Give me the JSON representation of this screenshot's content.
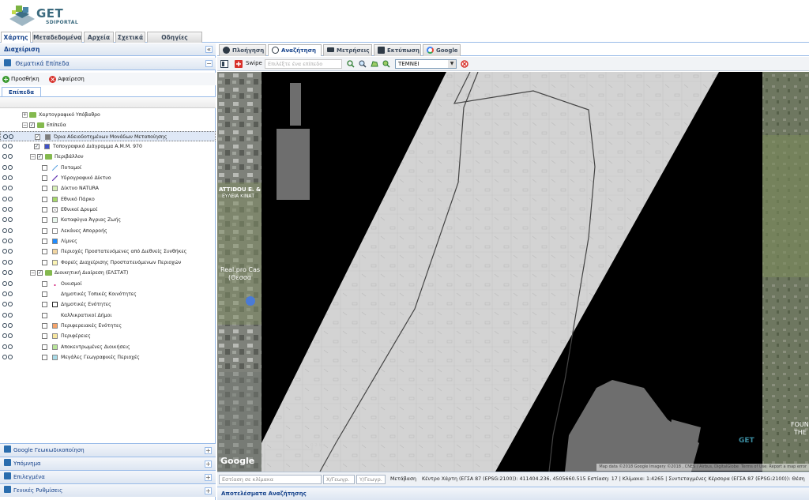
{
  "header": {
    "logo_title": "GET",
    "logo_subtitle": "SDIPORTAL"
  },
  "main_tabs": [
    {
      "label": "Χάρτης",
      "active": true
    },
    {
      "label": "Μεταδεδομένα",
      "active": false
    },
    {
      "label": "Αρχεία",
      "active": false
    },
    {
      "label": "Σχετικά",
      "active": false
    },
    {
      "label": "Οδηγίες Χρήσης",
      "active": false
    }
  ],
  "left_panel": {
    "title": "Διαχείριση",
    "thematic_title": "Θεματικά Επίπεδα",
    "add_label": "Προσθήκη",
    "remove_label": "Αφαίρεση",
    "layers_tab": "Επίπεδα",
    "tree": [
      {
        "label": "Χαρτογραφικό Υπόβαθρο",
        "indent": 0,
        "type": "folder",
        "expander": "+",
        "checked": false,
        "actions": false
      },
      {
        "label": "Επίπεδα",
        "indent": 0,
        "type": "folder",
        "expander": "-",
        "checked": true,
        "actions": false
      },
      {
        "label": "Όρια Αδειοδοτημένων Μονάδων Μεταποίησης",
        "indent": 1,
        "type": "layer",
        "checked": true,
        "actions": true,
        "selected": true,
        "symbol": "#7d7d7d"
      },
      {
        "label": "Τοπογραφικό Διάγραμμα Α.Μ.Μ. 970",
        "indent": 1,
        "type": "layer",
        "checked": true,
        "actions": true,
        "symbol": "#3f51c9"
      },
      {
        "label": "Περιβάλλον",
        "indent": 1,
        "type": "folder",
        "expander": "-",
        "checked": true,
        "actions": true
      },
      {
        "label": "Ποταμοί",
        "indent": 2,
        "type": "layer",
        "checked": false,
        "actions": true,
        "symbol": "line-blue"
      },
      {
        "label": "Υδρογραφικό Δίκτυο",
        "indent": 2,
        "type": "layer",
        "checked": false,
        "actions": true,
        "symbol": "line-purple"
      },
      {
        "label": "Δίκτυο NATURA",
        "indent": 2,
        "type": "layer",
        "checked": false,
        "actions": true,
        "symbol": "#d8f0b8"
      },
      {
        "label": "Εθνικό Πάρκο",
        "indent": 2,
        "type": "layer",
        "checked": false,
        "actions": true,
        "symbol": "#a6d96a"
      },
      {
        "label": "Εθνικοί Δρυμοί",
        "indent": 2,
        "type": "layer",
        "checked": false,
        "actions": true,
        "symbol": "hatch"
      },
      {
        "label": "Καταφύγια Άγριας Ζωής",
        "indent": 2,
        "type": "layer",
        "checked": false,
        "actions": true,
        "symbol": "#e7f7ec"
      },
      {
        "label": "Λεκάνες Απορροής",
        "indent": 2,
        "type": "layer",
        "checked": false,
        "actions": true,
        "symbol": "#ffffff"
      },
      {
        "label": "Λίμνες",
        "indent": 2,
        "type": "layer",
        "checked": false,
        "actions": true,
        "symbol": "#1f8cff"
      },
      {
        "label": "Περιοχές Προστατευόμενες από Διεθνείς Συνθήκες",
        "indent": 2,
        "type": "layer",
        "checked": false,
        "actions": true,
        "symbol": "#f2d6a2"
      },
      {
        "label": "Φορείς Διαχείρισης Προστατευόμενων Περιοχών",
        "indent": 2,
        "type": "layer",
        "checked": false,
        "actions": true,
        "symbol": "#fbf4b4"
      },
      {
        "label": "Διοικητική Διαίρεση (ΕΛΣΤΑΤ)",
        "indent": 1,
        "type": "folder",
        "expander": "-",
        "checked": true,
        "actions": true
      },
      {
        "label": "Οικισμοί",
        "indent": 2,
        "type": "layer",
        "checked": false,
        "actions": true,
        "symbol": "dot"
      },
      {
        "label": "Δημοτικές Τοπικές Κοινότητες",
        "indent": 2,
        "type": "layer",
        "checked": false,
        "actions": true,
        "symbol": "none"
      },
      {
        "label": "Δημοτικές Ενότητες",
        "indent": 2,
        "type": "layer",
        "checked": false,
        "actions": true,
        "symbol": "#ffffff-dark"
      },
      {
        "label": "Καλλικρατικοί Δήμοι",
        "indent": 2,
        "type": "layer",
        "checked": false,
        "actions": true,
        "symbol": "none"
      },
      {
        "label": "Περιφερειακές Ενότητες",
        "indent": 2,
        "type": "layer",
        "checked": false,
        "actions": true,
        "symbol": "#f6a46a"
      },
      {
        "label": "Περιφέρειες",
        "indent": 2,
        "type": "layer",
        "checked": false,
        "actions": true,
        "symbol": "#f7e6a0"
      },
      {
        "label": "Αποκεντρωμένες Διοικήσεις",
        "indent": 2,
        "type": "layer",
        "checked": false,
        "actions": true,
        "symbol": "#b9e59a"
      },
      {
        "label": "Μεγάλες Γεωγραφικές Περιοχές",
        "indent": 2,
        "type": "layer",
        "checked": false,
        "actions": true,
        "symbol": "#a9dbe8"
      }
    ],
    "bottom_sections": [
      "Google Γεωκωδικοποίηση",
      "Υπόμνημα",
      "Επιλεγμένα",
      "Γενικές Ρυθμίσεις"
    ]
  },
  "map_tabs": [
    {
      "label": "Πλοήγηση",
      "active": false
    },
    {
      "label": "Αναζήτηση",
      "active": true
    },
    {
      "label": "Μετρήσεις",
      "active": false
    },
    {
      "label": "Εκτύπωση",
      "active": false
    },
    {
      "label": "Google",
      "active": false
    }
  ],
  "map_toolbar": {
    "swipe_label": "Swipe",
    "layer_placeholder": "Επιλέξτε ένα επίπεδο",
    "operation_value": "ΤΕΜΝΕΙ"
  },
  "map": {
    "labels": [
      "ATTIDOU E. &",
      "ΕΥΛΕΙΑ ΚΙΝΑΤ",
      "Real.pro Cas",
      "(Θεσσα",
      "FOUN",
      "THE"
    ],
    "google_logo": "Google",
    "attribution": "Map data ©2018 Google Imagery ©2018 , CNES / Airbus, DigitalGlobe",
    "terms": "Terms of Use",
    "report": "Report a map error",
    "watermark": "GET",
    "scale_text": "0.2 km"
  },
  "status_bar": {
    "scale_placeholder": "Εστίαση σε κλίμακα",
    "x_placeholder": "Χ/Γεωγρ.",
    "y_placeholder": "Υ/Γεωγρ.",
    "transfer_label": "Μετάβαση",
    "info_text": "Κέντρο Χάρτη (ΕΓΣΑ 87 (EPSG:2100)): 411404.236, 4505660.515 Εστίαση: 17 | Κλίμακα: 1:4265 | Συντεταγμένες Κέρσορα (ΕΓΣΑ 87 (EPSG:2100)): Θέση"
  },
  "results_title": "Αποτελέσματα Αναζήτησης",
  "colors": {
    "accent": "#15428b",
    "border": "#99bbe8",
    "folder": "#84b94e",
    "remove": "#d8312b",
    "add": "#3a9a2f"
  }
}
